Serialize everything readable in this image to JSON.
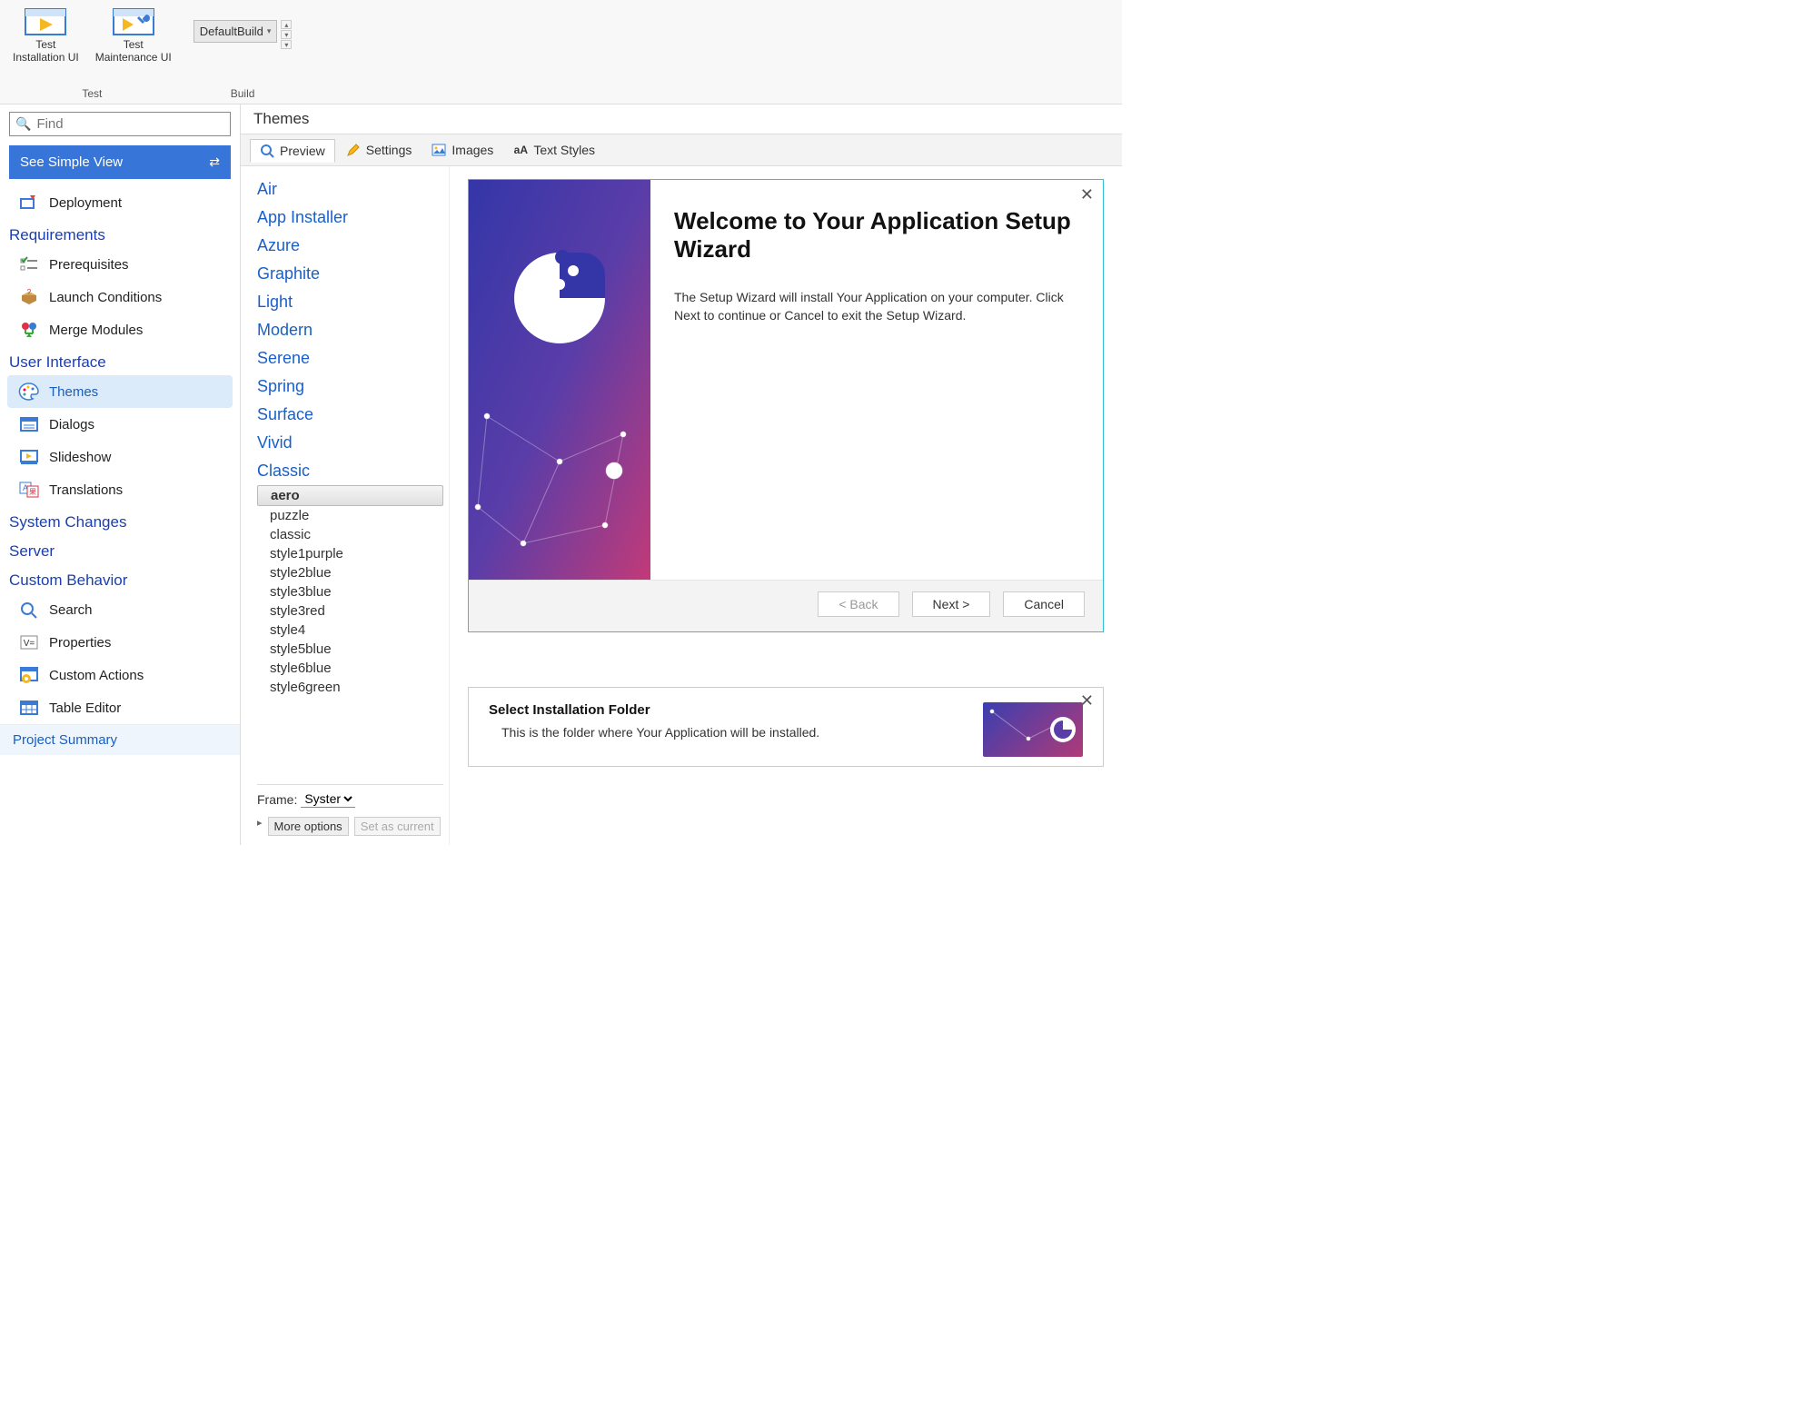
{
  "ribbon": {
    "test_group_label": "Test",
    "build_group_label": "Build",
    "test_install_label": "Test\nInstallation UI",
    "test_maint_label": "Test\nMaintenance UI",
    "build_combo": "DefaultBuild"
  },
  "sidebar": {
    "find_placeholder": "Find",
    "see_simple": "See Simple View",
    "items": {
      "deployment": "Deployment",
      "requirements": "Requirements",
      "prerequisites": "Prerequisites",
      "launch_conditions": "Launch Conditions",
      "merge_modules": "Merge Modules",
      "user_interface": "User Interface",
      "themes": "Themes",
      "dialogs": "Dialogs",
      "slideshow": "Slideshow",
      "translations": "Translations",
      "system_changes": "System Changes",
      "server": "Server",
      "custom_behavior": "Custom Behavior",
      "search": "Search",
      "properties": "Properties",
      "custom_actions": "Custom Actions",
      "table_editor": "Table Editor",
      "project_summary": "Project Summary"
    }
  },
  "content": {
    "title": "Themes",
    "tabs": {
      "preview": "Preview",
      "settings": "Settings",
      "images": "Images",
      "text_styles": "Text Styles"
    }
  },
  "themes": {
    "categories": [
      "Air",
      "App Installer",
      "Azure",
      "Graphite",
      "Light",
      "Modern",
      "Serene",
      "Spring",
      "Surface",
      "Vivid",
      "Classic"
    ],
    "classic_children": [
      "aero",
      "puzzle",
      "classic",
      "style1purple",
      "style2blue",
      "style3blue",
      "style3red",
      "style4",
      "style5blue",
      "style6blue",
      "style6green"
    ],
    "selected_child": "aero",
    "frame_label": "Frame:",
    "frame_value": "Syster",
    "more_options": "More options",
    "set_as_current": "Set as current"
  },
  "wizard1": {
    "title": "Welcome to Your Application Setup Wizard",
    "body": "The Setup Wizard will install Your Application on your computer. Click Next to continue or Cancel to exit the Setup Wizard.",
    "back": "< Back",
    "next": "Next >",
    "cancel": "Cancel"
  },
  "wizard2": {
    "title": "Select Installation Folder",
    "body": "This is the folder where Your Application will be installed."
  }
}
